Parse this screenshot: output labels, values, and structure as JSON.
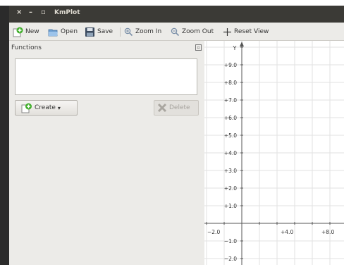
{
  "window": {
    "title": "KmPlot",
    "controls": {
      "close": "×",
      "minimize": "–",
      "maximize": "▫"
    }
  },
  "toolbar": {
    "new_label": "New",
    "open_label": "Open",
    "save_label": "Save",
    "zoom_in_label": "Zoom In",
    "zoom_out_label": "Zoom Out",
    "reset_view_label": "Reset View"
  },
  "functions_panel": {
    "title": "Functions",
    "create_label": "Create",
    "create_arrow": "▾",
    "delete_label": "Delete",
    "functions": []
  },
  "plot": {
    "y_axis_label": "Y",
    "y_ticks": [
      "+9.0",
      "+8.0",
      "+7.0",
      "+6.0",
      "+5.0",
      "+4.0",
      "+3.0",
      "+2.0",
      "+1.0",
      "−1.0",
      "−2.0"
    ],
    "x_ticks": [
      "−2.0",
      "+4.0",
      "+8.0"
    ],
    "grid": true
  },
  "colors": {
    "title_bar": "#3b3a36",
    "toolbar": "#ecebe8",
    "panel": "#ecebe8",
    "grid": "#e2e2e2",
    "axis": "#555555",
    "add_icon_green": "#3fae29"
  }
}
